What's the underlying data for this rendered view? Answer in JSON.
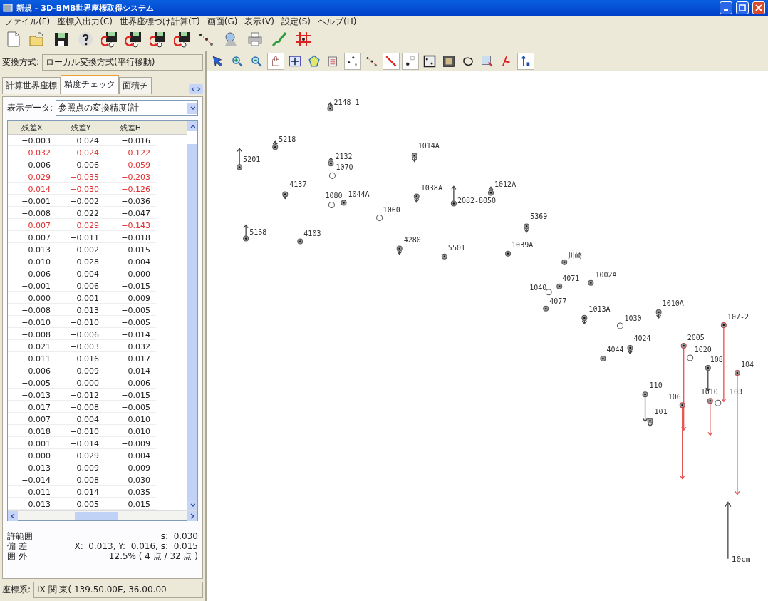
{
  "window": {
    "title": "新規 - 3D-BMB世界座標取得システム"
  },
  "menu": [
    "ファイル(F)",
    "座標入出力(C)",
    "世界座標づけ計算(T)",
    "画面(G)",
    "表示(V)",
    "設定(S)",
    "ヘルプ(H)"
  ],
  "toolbar": [
    {
      "kind": "new"
    },
    {
      "kind": "open"
    },
    {
      "kind": "save"
    },
    {
      "kind": "help"
    },
    {
      "kind": "calc"
    },
    {
      "kind": "calc"
    },
    {
      "kind": "calc"
    },
    {
      "kind": "calc"
    },
    {
      "kind": "network"
    },
    {
      "kind": "search"
    },
    {
      "kind": "print"
    },
    {
      "kind": "japan"
    },
    {
      "kind": "grid"
    }
  ],
  "transform": {
    "label": "変換方式:",
    "value": "ローカル変換方式(平行移動)"
  },
  "tabs": [
    {
      "label": "計算世界座標",
      "selected": false
    },
    {
      "label": "精度チェック",
      "selected": true
    },
    {
      "label": "面積チ",
      "selected": false
    }
  ],
  "display": {
    "label": "表示データ:",
    "value": "参照点の変換精度(計"
  },
  "table": {
    "columns": [
      "残差X",
      "残差Y",
      "残差H"
    ],
    "rows": [
      {
        "cells": [
          "−0.003",
          "0.024",
          "−0.016"
        ],
        "exceeds": false
      },
      {
        "cells": [
          "−0.032",
          "−0.024",
          "−0.122"
        ],
        "exceeds": true
      },
      {
        "cells": [
          "−0.006",
          "−0.006",
          "−0.059"
        ],
        "exceeds": false,
        "h_exceeds": true
      },
      {
        "cells": [
          "0.029",
          "−0.035",
          "−0.203"
        ],
        "exceeds": true
      },
      {
        "cells": [
          "0.014",
          "−0.030",
          "−0.126"
        ],
        "exceeds": true
      },
      {
        "cells": [
          "−0.001",
          "−0.002",
          "−0.036"
        ],
        "exceeds": false
      },
      {
        "cells": [
          "−0.008",
          "0.022",
          "−0.047"
        ],
        "exceeds": false
      },
      {
        "cells": [
          "0.007",
          "0.029",
          "−0.143"
        ],
        "exceeds": true
      },
      {
        "cells": [
          "0.007",
          "−0.011",
          "−0.018"
        ],
        "exceeds": false
      },
      {
        "cells": [
          "−0.013",
          "0.002",
          "−0.015"
        ],
        "exceeds": false
      },
      {
        "cells": [
          "−0.010",
          "0.028",
          "−0.004"
        ],
        "exceeds": false
      },
      {
        "cells": [
          "−0.006",
          "0.004",
          "0.000"
        ],
        "exceeds": false
      },
      {
        "cells": [
          "−0.001",
          "0.006",
          "−0.015"
        ],
        "exceeds": false
      },
      {
        "cells": [
          "0.000",
          "0.001",
          "0.009"
        ],
        "exceeds": false
      },
      {
        "cells": [
          "−0.008",
          "0.013",
          "−0.005"
        ],
        "exceeds": false
      },
      {
        "cells": [
          "−0.010",
          "−0.010",
          "−0.005"
        ],
        "exceeds": false
      },
      {
        "cells": [
          "−0.008",
          "−0.006",
          "−0.014"
        ],
        "exceeds": false
      },
      {
        "cells": [
          "0.021",
          "−0.003",
          "0.032"
        ],
        "exceeds": false
      },
      {
        "cells": [
          "0.011",
          "−0.016",
          "0.017"
        ],
        "exceeds": false
      },
      {
        "cells": [
          "−0.006",
          "−0.009",
          "−0.014"
        ],
        "exceeds": false
      },
      {
        "cells": [
          "−0.005",
          "0.000",
          "0.006"
        ],
        "exceeds": false
      },
      {
        "cells": [
          "−0.013",
          "−0.012",
          "−0.015"
        ],
        "exceeds": false
      },
      {
        "cells": [
          "0.017",
          "−0.008",
          "−0.005"
        ],
        "exceeds": false
      },
      {
        "cells": [
          "0.007",
          "0.004",
          "0.010"
        ],
        "exceeds": false
      },
      {
        "cells": [
          "0.018",
          "−0.010",
          "0.010"
        ],
        "exceeds": false
      },
      {
        "cells": [
          "0.001",
          "−0.014",
          "−0.009"
        ],
        "exceeds": false
      },
      {
        "cells": [
          "0.000",
          "0.029",
          "0.004"
        ],
        "exceeds": false
      },
      {
        "cells": [
          "−0.013",
          "0.009",
          "−0.009"
        ],
        "exceeds": false
      },
      {
        "cells": [
          "−0.014",
          "0.008",
          "0.030"
        ],
        "exceeds": false
      },
      {
        "cells": [
          "0.011",
          "0.014",
          "0.035"
        ],
        "exceeds": false
      },
      {
        "cells": [
          "0.013",
          "0.005",
          "0.015"
        ],
        "exceeds": false
      }
    ]
  },
  "stats": [
    {
      "label": "許範囲",
      "value": "s:  0.030"
    },
    {
      "label": "偏 差",
      "value": "X:  0.013, Y:  0.016, s:  0.015"
    },
    {
      "label": "囲 外",
      "value": "12.5% ( 4 点 / 32 点 )"
    }
  ],
  "coordinate_system": {
    "label": "座標系:",
    "value": "IX 関 東( 139.50.00E, 36.00.00"
  },
  "canvas_tools": [
    {
      "kind": "select",
      "pressed": false
    },
    {
      "kind": "zoom-in",
      "pressed": false
    },
    {
      "kind": "zoom-out",
      "pressed": false
    },
    {
      "kind": "pan",
      "pressed": true
    },
    {
      "kind": "fit",
      "pressed": false
    },
    {
      "kind": "polygon",
      "pressed": false
    },
    {
      "kind": "edit",
      "pressed": false
    },
    {
      "kind": "points",
      "pressed": true
    },
    {
      "kind": "network",
      "pressed": false
    },
    {
      "kind": "vector",
      "pressed": true
    },
    {
      "kind": "label",
      "pressed": true
    },
    {
      "kind": "frame",
      "pressed": false
    },
    {
      "kind": "image",
      "pressed": false
    },
    {
      "kind": "lasso",
      "pressed": false
    },
    {
      "kind": "map",
      "pressed": false
    },
    {
      "kind": "xy",
      "pressed": false
    },
    {
      "kind": "height",
      "pressed": true
    }
  ],
  "points": [
    {
      "label": "2148-1",
      "kind": "filled",
      "up": true,
      "down": false,
      "exceeds": false
    },
    {
      "label": "5218",
      "kind": "filled",
      "up": true,
      "down": false,
      "exceeds": false
    },
    {
      "label": "5201",
      "kind": "filled",
      "up": true,
      "down": false,
      "exceeds": false
    },
    {
      "label": "2132",
      "kind": "filled",
      "up": true,
      "down": false,
      "exceeds": false
    },
    {
      "label": "1070",
      "kind": "hollow",
      "up": false,
      "down": false,
      "exceeds": false
    },
    {
      "label": "1014A",
      "kind": "filled",
      "up": false,
      "down": true,
      "exceeds": false
    },
    {
      "label": "4137",
      "kind": "filled",
      "up": false,
      "down": true,
      "exceeds": false
    },
    {
      "label": "1080",
      "kind": "hollow",
      "up": false,
      "down": false,
      "exceeds": false
    },
    {
      "label": "1044A",
      "kind": "filled",
      "up": false,
      "down": false,
      "exceeds": false
    },
    {
      "label": "1060",
      "kind": "hollow",
      "up": false,
      "down": false,
      "exceeds": false
    },
    {
      "label": "1038A",
      "kind": "filled",
      "up": false,
      "down": true,
      "exceeds": false
    },
    {
      "label": "2082-8050",
      "kind": "filled",
      "up": true,
      "down": false,
      "exceeds": false
    },
    {
      "label": "1012A",
      "kind": "filled",
      "up": true,
      "down": false,
      "exceeds": false
    },
    {
      "label": "5369",
      "kind": "filled",
      "up": false,
      "down": true,
      "exceeds": false
    },
    {
      "label": "5168",
      "kind": "filled",
      "up": true,
      "down": false,
      "exceeds": false
    },
    {
      "label": "4103",
      "kind": "filled",
      "up": false,
      "down": false,
      "exceeds": false
    },
    {
      "label": "4280",
      "kind": "filled",
      "up": false,
      "down": true,
      "exceeds": false
    },
    {
      "label": "5501",
      "kind": "filled",
      "up": false,
      "down": false,
      "exceeds": false
    },
    {
      "label": "1039A",
      "kind": "filled",
      "up": false,
      "down": false,
      "exceeds": false
    },
    {
      "label": "川崎",
      "kind": "filled",
      "up": false,
      "down": false,
      "exceeds": false
    },
    {
      "label": "4071",
      "kind": "filled",
      "up": false,
      "down": false,
      "exceeds": false
    },
    {
      "label": "1040",
      "kind": "hollow",
      "up": false,
      "down": false,
      "exceeds": false
    },
    {
      "label": "1002A",
      "kind": "filled",
      "up": false,
      "down": false,
      "exceeds": false
    },
    {
      "label": "4077",
      "kind": "filled",
      "up": false,
      "down": false,
      "exceeds": false
    },
    {
      "label": "1013A",
      "kind": "filled",
      "up": false,
      "down": true,
      "exceeds": false
    },
    {
      "label": "1030",
      "kind": "hollow",
      "up": false,
      "down": false,
      "exceeds": false
    },
    {
      "label": "1010A",
      "kind": "filled",
      "up": false,
      "down": true,
      "exceeds": false
    },
    {
      "label": "4024",
      "kind": "filled",
      "up": false,
      "down": true,
      "exceeds": false
    },
    {
      "label": "4044",
      "kind": "filled",
      "up": false,
      "down": false,
      "exceeds": false
    },
    {
      "label": "107-2",
      "kind": "filled",
      "up": false,
      "down": true,
      "exceeds": true
    },
    {
      "label": "2005",
      "kind": "filled",
      "up": false,
      "down": true,
      "exceeds": true
    },
    {
      "label": "1020",
      "kind": "hollow",
      "up": false,
      "down": false,
      "exceeds": false
    },
    {
      "label": "108",
      "kind": "filled",
      "up": false,
      "down": true,
      "exceeds": false
    },
    {
      "label": "104",
      "kind": "filled",
      "up": false,
      "down": true,
      "exceeds": true
    },
    {
      "label": "110",
      "kind": "filled",
      "up": false,
      "down": true,
      "exceeds": false
    },
    {
      "label": "101",
      "kind": "filled",
      "up": false,
      "down": true,
      "exceeds": false
    },
    {
      "label": "106",
      "kind": "filled",
      "up": false,
      "down": true,
      "exceeds": true
    },
    {
      "label": "1010",
      "kind": "filled",
      "up": false,
      "down": true,
      "exceeds": true
    },
    {
      "label": "103",
      "kind": "hollow",
      "up": false,
      "down": false,
      "exceeds": false
    }
  ],
  "scale": {
    "label": "10cm"
  }
}
